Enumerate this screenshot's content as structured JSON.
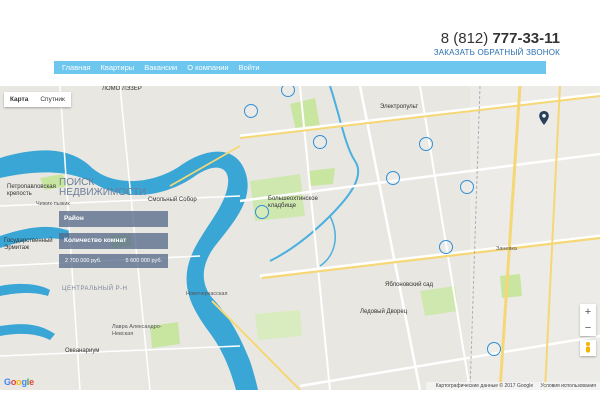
{
  "header": {
    "phone_prefix": "8 (812)",
    "phone_number": "777-33-11",
    "callback_label": "ЗАКАЗАТЬ ОБРАТНЫЙ ЗВОНОК"
  },
  "nav": {
    "items": [
      "Главная",
      "Квартиры",
      "Вакансии",
      "О компании",
      "Войти"
    ]
  },
  "map": {
    "type_controls": [
      "Карта",
      "Спутник"
    ],
    "zoom_in": "+",
    "zoom_out": "−",
    "google_logo": "Google",
    "attribution": "Картографические данные © 2017 Google",
    "terms": "Условия использования",
    "labels": {
      "lomo": "ЛОМО ЛЭЗЕР",
      "elektropult": "Электропульт",
      "petropavlovsk": "Петропавловская крепость",
      "smolny": "Смольный Собор",
      "chizhik": "Чижик-пыжик",
      "hermitage": "Государственный Эрмитаж",
      "cathedral": "Большеохтинское кладбище",
      "yablonovsky": "Яблоновский сад",
      "ice_palace": "Ледовый Дворец",
      "zanevka": "Заневка",
      "oceanarium": "Океанариум",
      "central": "ЦЕНТРАЛЬНЫЙ Р-Н",
      "aleksandro": "Лавра Александро-Невская",
      "novocherkasskaya": "Новочеркасская"
    }
  },
  "search": {
    "title": "Поиск Недвижимости",
    "district_label": "Район",
    "rooms_label": "Количество комнат",
    "price_min": "2 700 000 руб.",
    "price_max": "5 600 000 руб."
  },
  "colors": {
    "accent": "#6cc6ee",
    "marker": "#2f8fd8",
    "water": "#3aa6d6",
    "park": "#c8e6a0"
  }
}
